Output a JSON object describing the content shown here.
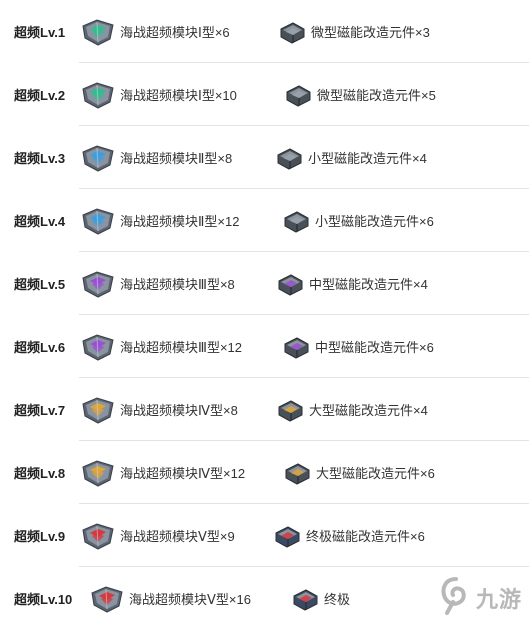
{
  "rows": [
    {
      "level": "超频Lv.1",
      "module": "海战超频模块Ⅰ型×6",
      "part": "微型磁能改造元件×3",
      "tier": 1
    },
    {
      "level": "超频Lv.2",
      "module": "海战超频模块Ⅰ型×10",
      "part": "微型磁能改造元件×5",
      "tier": 1
    },
    {
      "level": "超频Lv.3",
      "module": "海战超频模块Ⅱ型×8",
      "part": "小型磁能改造元件×4",
      "tier": 2
    },
    {
      "level": "超频Lv.4",
      "module": "海战超频模块Ⅱ型×12",
      "part": "小型磁能改造元件×6",
      "tier": 2
    },
    {
      "level": "超频Lv.5",
      "module": "海战超频模块Ⅲ型×8",
      "part": "中型磁能改造元件×4",
      "tier": 3
    },
    {
      "level": "超频Lv.6",
      "module": "海战超频模块Ⅲ型×12",
      "part": "中型磁能改造元件×6",
      "tier": 3
    },
    {
      "level": "超频Lv.7",
      "module": "海战超频模块Ⅳ型×8",
      "part": "大型磁能改造元件×4",
      "tier": 4
    },
    {
      "level": "超频Lv.8",
      "module": "海战超频模块Ⅳ型×12",
      "part": "大型磁能改造元件×6",
      "tier": 4
    },
    {
      "level": "超频Lv.9",
      "module": "海战超频模块Ⅴ型×9",
      "part": "终极磁能改造元件×6",
      "tier": 5
    },
    {
      "level": "超频Lv.10",
      "module": "海战超频模块Ⅴ型×16",
      "part": "终极",
      "tier": 5
    }
  ],
  "tier_colors": {
    "1": "#2fbf8f",
    "2": "#3a9fe0",
    "3": "#9b4fd6",
    "4": "#e0a437",
    "5": "#d9363e"
  },
  "icons": {
    "module": "armor-module-icon",
    "part": "magnetic-part-icon"
  },
  "watermark": {
    "text": "九游",
    "icon": "jiuyou-logo-icon"
  }
}
